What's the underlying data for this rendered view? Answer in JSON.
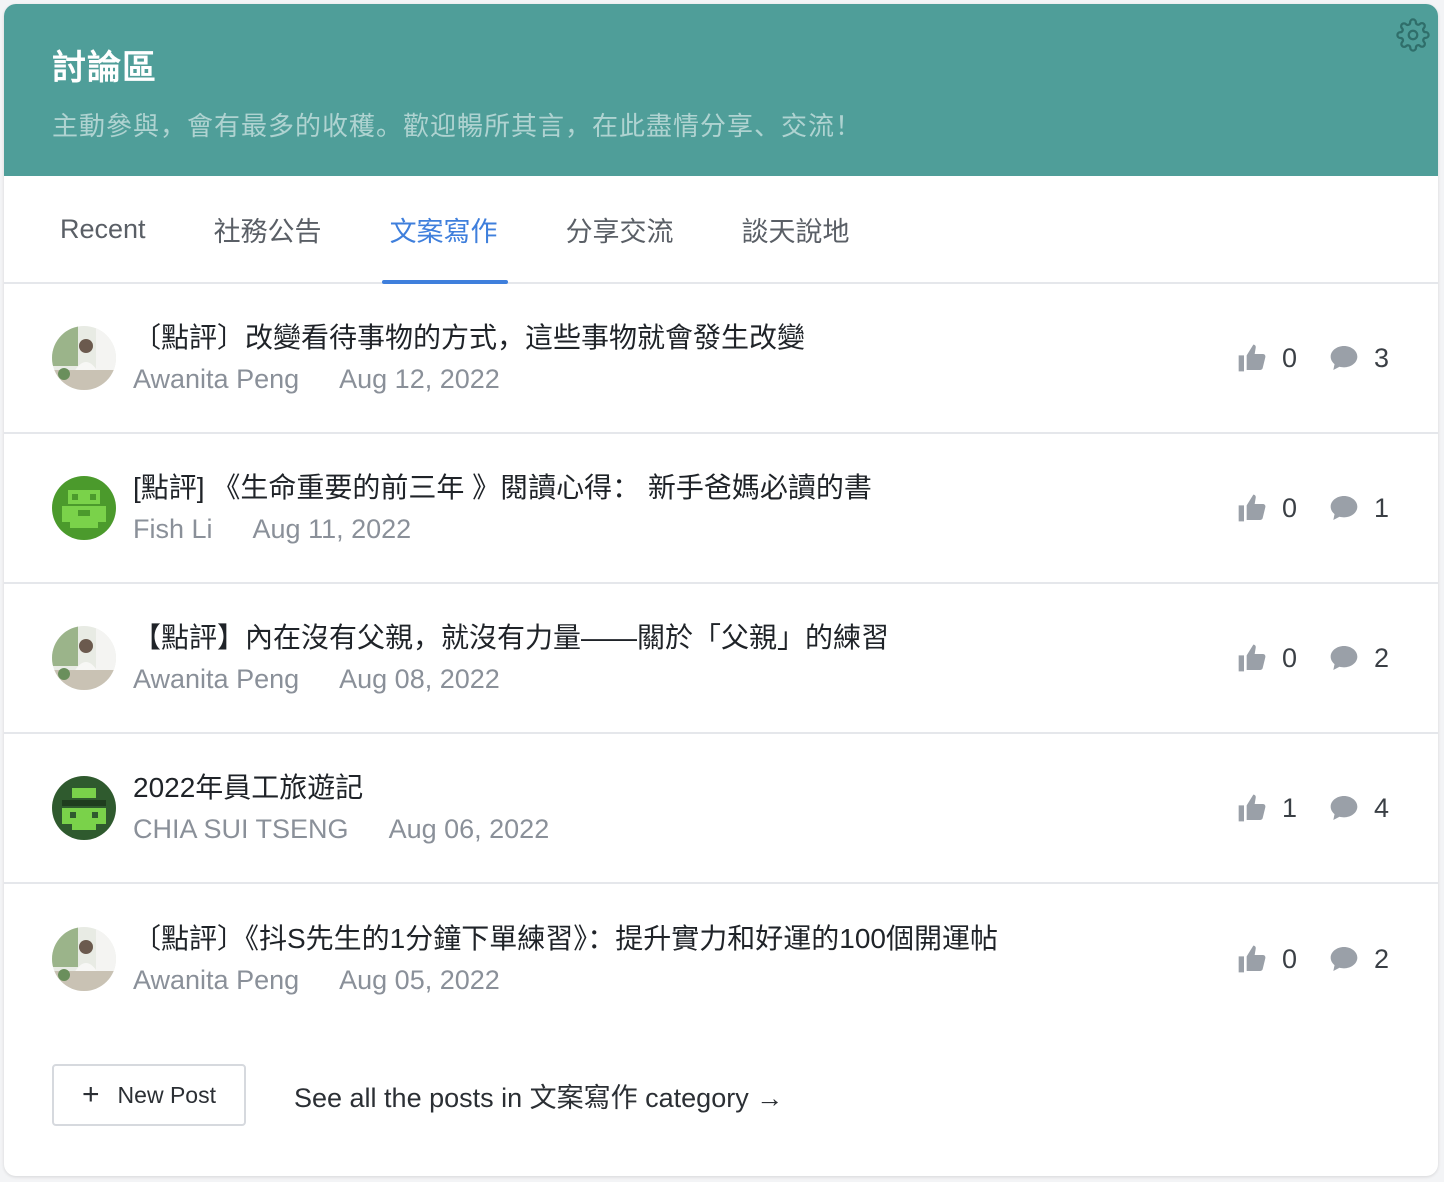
{
  "header": {
    "title": "討論區",
    "subtitle": "主動參與，會有最多的收穫。歡迎暢所其言，在此盡情分享、交流！",
    "settings_icon": "gear-icon"
  },
  "tabs": [
    {
      "label": "Recent",
      "active": false
    },
    {
      "label": "社務公告",
      "active": false
    },
    {
      "label": "文案寫作",
      "active": true
    },
    {
      "label": "分享交流",
      "active": false
    },
    {
      "label": "談天說地",
      "active": false
    }
  ],
  "posts": [
    {
      "title": "〔點評〕改變看待事物的方式，這些事物就會發生改變",
      "author": "Awanita Peng",
      "date": "Aug 12, 2022",
      "likes": "0",
      "comments": "3",
      "avatar": "photo"
    },
    {
      "title": "[點評] 《生命重要的前三年 》閱讀心得： 新手爸媽必讀的書",
      "author": "Fish Li",
      "date": "Aug 11, 2022",
      "likes": "0",
      "comments": "1",
      "avatar": "pixel-green"
    },
    {
      "title": "【點評】內在沒有父親，就沒有力量——關於「父親」的練習",
      "author": "Awanita Peng",
      "date": "Aug 08, 2022",
      "likes": "0",
      "comments": "2",
      "avatar": "photo"
    },
    {
      "title": "2022年員工旅遊記",
      "author": "CHIA SUI TSENG",
      "date": "Aug 06, 2022",
      "likes": "1",
      "comments": "4",
      "avatar": "pixel-dark"
    },
    {
      "title": "〔點評〕《抖S先生的1分鐘下單練習》：提升實力和好運的100個開運帖",
      "author": "Awanita Peng",
      "date": "Aug 05, 2022",
      "likes": "0",
      "comments": "2",
      "avatar": "photo"
    }
  ],
  "footer": {
    "new_post_label": "New Post",
    "see_all_label": "See all the posts in 文案寫作 category →"
  },
  "colors": {
    "header_bg": "#4f9e99",
    "active_tab": "#3f7fdc",
    "icon_gray": "#9aa0a8"
  }
}
